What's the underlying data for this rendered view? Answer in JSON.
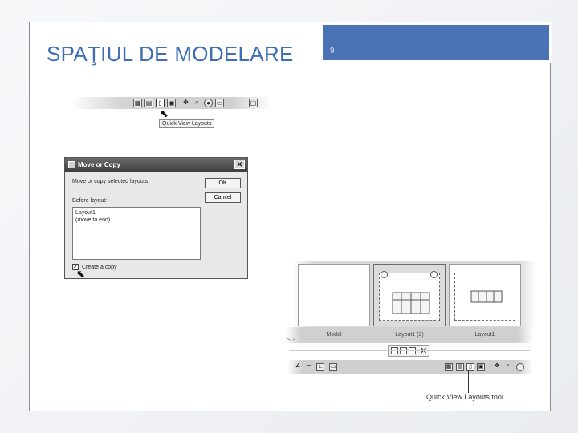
{
  "slide": {
    "page_number": "9",
    "title": "SPAŢIUL DE MODELARE"
  },
  "toolbar_top": {
    "tooltip": "Quick View Layouts"
  },
  "dialog": {
    "title": "Move or Copy",
    "close_glyph": "✕",
    "prompt": "Move or copy selected layouts",
    "before_layout_label": "Before layout:",
    "list_items": [
      "Layout1",
      "(move to end)"
    ],
    "ok_label": "OK",
    "cancel_label": "Cancel",
    "checkbox_label": "Create a copy",
    "checkbox_checked": true
  },
  "layouts_panel": {
    "thumbs": [
      {
        "label": "Model",
        "active": false
      },
      {
        "label": "Layout1 (2)",
        "active": true
      },
      {
        "label": "Layout1",
        "active": false
      }
    ],
    "side_note": "< >"
  },
  "mini_toolbar": {
    "close_glyph": "✕"
  },
  "status_bar": {
    "callout": "Quick View Layouts tool"
  },
  "icons": [
    "layout-icon",
    "pan-icon",
    "zoom-icon",
    "steering-wheel-icon",
    "showmotion-icon",
    "close-icon",
    "pin-icon",
    "new-layout-icon",
    "publish-icon"
  ]
}
